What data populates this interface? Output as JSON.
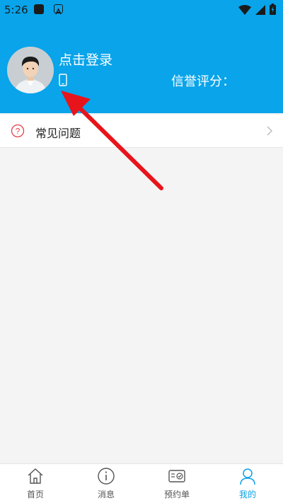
{
  "status_bar": {
    "time": "5:26"
  },
  "profile": {
    "login_prompt": "点击登录",
    "credit_label": "信誉评分："
  },
  "menu": {
    "faq_label": "常见问题"
  },
  "tabbar": {
    "items": [
      {
        "label": "首页",
        "icon": "home-icon"
      },
      {
        "label": "消息",
        "icon": "info-icon"
      },
      {
        "label": "预约单",
        "icon": "ticket-icon"
      },
      {
        "label": "我的",
        "icon": "person-icon"
      }
    ],
    "active_index": 3
  },
  "colors": {
    "header": "#09a4ea",
    "active_tab": "#0aa0e6",
    "annotation_arrow": "#e8141b"
  }
}
